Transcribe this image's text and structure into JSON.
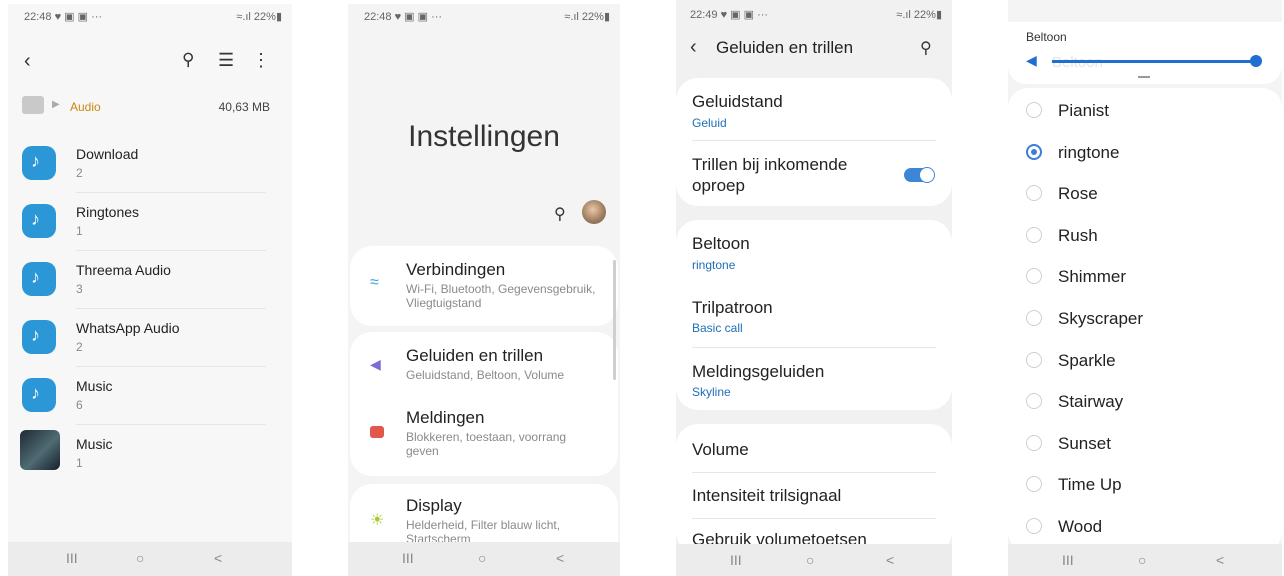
{
  "screen1": {
    "time": "22:48 ♥ ▣ ▣ ···",
    "signal": "≈.ıl 22%▮",
    "path_label": "Audio",
    "size": "40,63 MB",
    "items": [
      {
        "name": "Download",
        "count": "2"
      },
      {
        "name": "Ringtones",
        "count": "1"
      },
      {
        "name": "Threema Audio",
        "count": "3"
      },
      {
        "name": "WhatsApp Audio",
        "count": "2"
      },
      {
        "name": "Music",
        "count": "6"
      },
      {
        "name": "Music",
        "count": "1"
      }
    ]
  },
  "screen2": {
    "time": "22:48 ♥ ▣ ▣ ···",
    "signal": "≈.ıl 22%▮",
    "title": "Instellingen",
    "items": [
      {
        "title": "Verbindingen",
        "sub": "Wi-Fi, Bluetooth, Gegevensgebruik, Vliegtuigstand",
        "color": "#3aa6d8"
      },
      {
        "title": "Geluiden en trillen",
        "sub": "Geluidstand, Beltoon, Volume",
        "color": "#7b6cd6"
      },
      {
        "title": "Meldingen",
        "sub": "Blokkeren, toestaan, voorrang geven",
        "color": "#e2574c"
      },
      {
        "title": "Display",
        "sub": "Helderheid, Filter blauw licht, Startscherm",
        "color": "#a6c92b"
      }
    ]
  },
  "screen3": {
    "time": "22:49 ♥ ▣ ▣ ···",
    "signal": "≈.ıl 22%▮",
    "header": "Geluiden en trillen",
    "geluidstand": {
      "title": "Geluidstand",
      "value": "Geluid"
    },
    "trillen": {
      "title": "Trillen bij inkomende oproep",
      "on": true
    },
    "beltoon": {
      "title": "Beltoon",
      "value": "ringtone"
    },
    "trilpatroon": {
      "title": "Trilpatroon",
      "value": "Basic call"
    },
    "meldingsgeluiden": {
      "title": "Meldingsgeluiden",
      "value": "Skyline"
    },
    "volume": "Volume",
    "intensiteit": "Intensiteit trilsignaal",
    "gebruik": "Gebruik volumetoetsen"
  },
  "screen4": {
    "slider_label": "Beltoon",
    "slider_ghost": "Beltoon",
    "slider_level": 1.0,
    "accent": "#1e6fd0",
    "selected": "ringtone",
    "options": [
      "Pianist",
      "ringtone",
      "Rose",
      "Rush",
      "Shimmer",
      "Skyscraper",
      "Sparkle",
      "Stairway",
      "Sunset",
      "Time Up",
      "Wood"
    ]
  },
  "nav": {
    "recent": "III",
    "home": "○",
    "back": "<"
  }
}
